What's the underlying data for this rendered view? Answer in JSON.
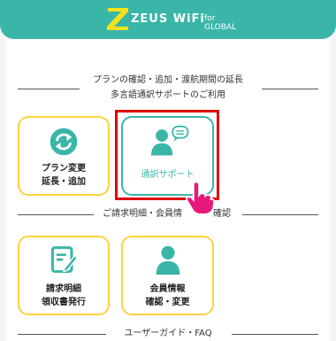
{
  "header": {
    "logo_letter": "Z",
    "brand": "ZEUS WiFi",
    "subtitle": "for GLOBAL"
  },
  "section1": {
    "title_line1": "プランの確認・追加・渡航期間の延長",
    "title_line2": "多言語通訳サポートのご利用"
  },
  "tiles1": [
    {
      "label_line1": "プラン変更",
      "label_line2": "延長・追加",
      "icon": "refresh-icon"
    },
    {
      "label_line1": "通訳サポート",
      "label_line2": "",
      "icon": "support-chat-icon"
    }
  ],
  "section2": {
    "title": "ご請求明細・会員情",
    "title_tail": "確認"
  },
  "tiles2": [
    {
      "label_line1": "請求明細",
      "label_line2": "領収書発行",
      "icon": "invoice-icon"
    },
    {
      "label_line1": "会員情報",
      "label_line2": "確認・変更",
      "icon": "member-icon"
    }
  ],
  "section3": {
    "title": "ユーザーガイド・FAQ"
  },
  "colors": {
    "accent": "#3ab6a8",
    "tile_border": "#ffd23f",
    "highlight": "#e00000",
    "pointer": "#e6197c"
  }
}
